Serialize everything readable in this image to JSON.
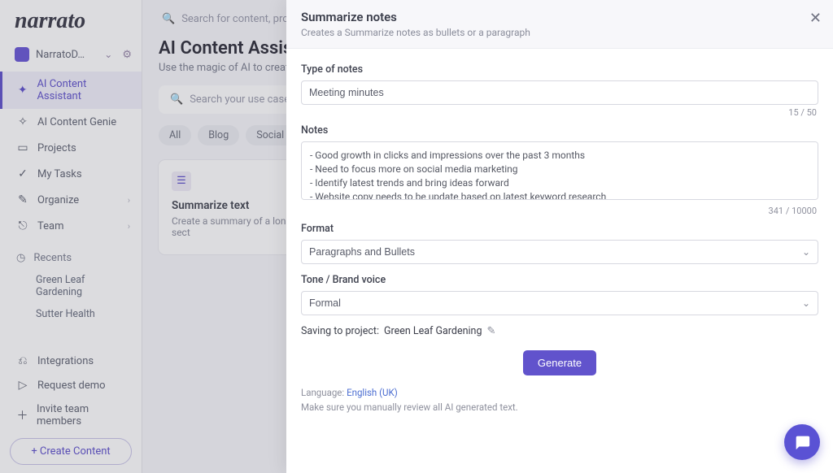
{
  "brand": "narrato",
  "workspace": {
    "name": "NarratoD…"
  },
  "sidebar": {
    "items": [
      {
        "name": "ai-content-assistant",
        "label": "AI Content Assistant",
        "icon": "✦",
        "active": true
      },
      {
        "name": "ai-content-genie",
        "label": "AI Content Genie",
        "icon": "✧"
      },
      {
        "name": "projects",
        "label": "Projects",
        "icon": "▭"
      },
      {
        "name": "my-tasks",
        "label": "My Tasks",
        "icon": "✓"
      },
      {
        "name": "organize",
        "label": "Organize",
        "icon": "✎",
        "expandable": true
      },
      {
        "name": "team",
        "label": "Team",
        "icon": "⎋",
        "expandable": true
      }
    ]
  },
  "recents": {
    "heading": "Recents",
    "items": [
      "Green Leaf Gardening",
      "Sutter Health"
    ]
  },
  "footer_nav": [
    {
      "name": "integrations",
      "label": "Integrations",
      "icon": "⎌"
    },
    {
      "name": "request-demo",
      "label": "Request demo",
      "icon": "▷"
    },
    {
      "name": "invite",
      "label": "Invite team members",
      "icon": "＋"
    }
  ],
  "create_button": "+ Create Content",
  "top_search_placeholder": "Search for content, projects, e",
  "page": {
    "title": "AI Content Assistant",
    "subtitle": "Use the magic of AI to create",
    "usecase_search_placeholder": "Search your use case",
    "pills": [
      "All",
      "Blog",
      "Social Media"
    ],
    "card": {
      "title": "Summarize text",
      "desc": "Create a summary of a long sect"
    }
  },
  "panel": {
    "title": "Summarize notes",
    "desc": "Creates a Summarize notes as bullets or a paragraph",
    "labels": {
      "type": "Type of notes",
      "notes": "Notes",
      "format": "Format",
      "tone": "Tone / Brand voice"
    },
    "values": {
      "type": "Meeting minutes",
      "notes": "- Good growth in clicks and impressions over the past 3 months\n- Need to focus more on social media marketing\n- Identify latest trends and bring ideas forward\n- Website copy needs to be update based on latest keyword research",
      "format": "Paragraphs and Bullets",
      "tone": "Formal"
    },
    "type_counter": "15 / 50",
    "notes_counter": "341 / 10000",
    "saving_label": "Saving to project:",
    "saving_project": "Green Leaf Gardening",
    "generate": "Generate",
    "language_label": "Language:",
    "language_value": "English (UK)",
    "disclaimer": "Make sure you manually review all AI generated text."
  }
}
